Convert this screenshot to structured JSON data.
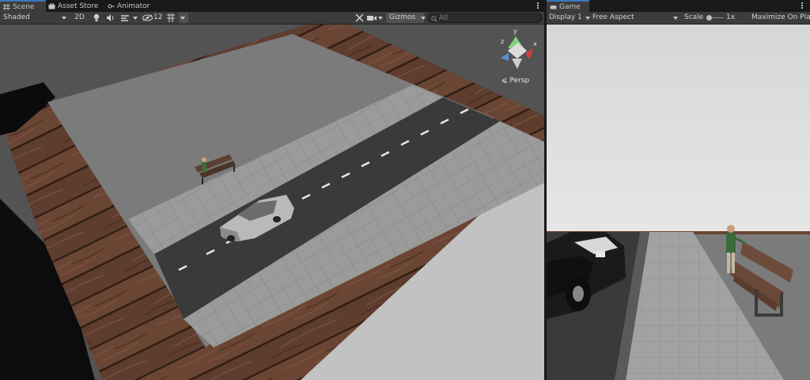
{
  "scene_panel": {
    "tabs": [
      {
        "label": "Scene",
        "icon": "hash-grid-icon",
        "active": true
      },
      {
        "label": "Asset Store",
        "icon": "shopping-bag-icon",
        "active": false
      },
      {
        "label": "Animator",
        "icon": "animator-icon",
        "active": false
      }
    ],
    "toolbar": {
      "shading_mode": "Shaded",
      "mode_2d": "2D",
      "hidden_count": "12",
      "gizmos_label": "Gizmos",
      "search_placeholder": "All"
    },
    "gizmo": {
      "axis_x": "x",
      "axis_y": "y",
      "axis_z": "z",
      "projection": "Persp"
    }
  },
  "game_panel": {
    "tab_label": "Game",
    "display_label": "Display 1",
    "aspect_label": "Free Aspect",
    "scale_label": "Scale",
    "scale_value": "1x",
    "maximize_label": "Maximize On Play"
  },
  "colors": {
    "accent": "#3a79bb",
    "panel": "#3c3c3c",
    "background": "#191919"
  }
}
